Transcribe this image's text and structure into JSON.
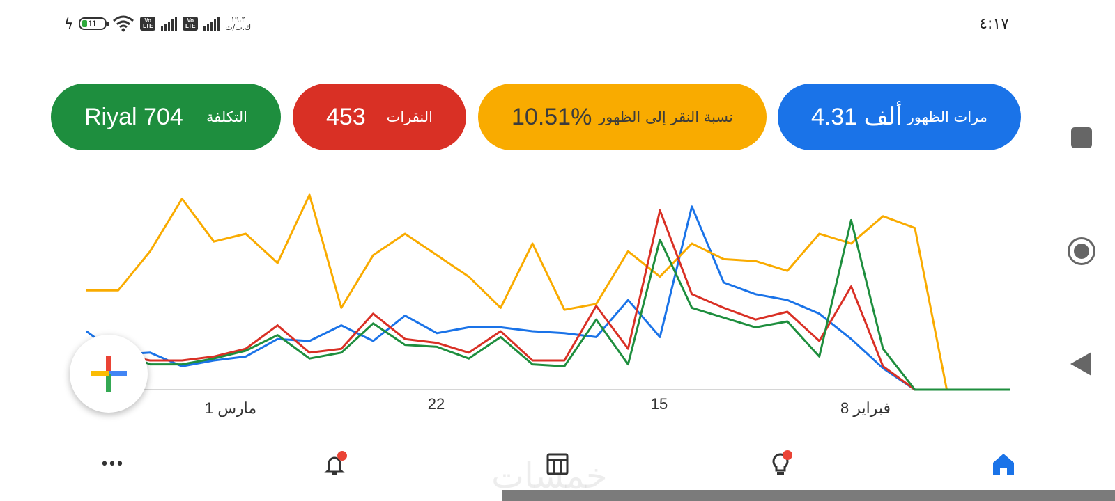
{
  "status_bar": {
    "time": "٤:١٧",
    "battery": "11",
    "network_speed_value": "١٩,٢",
    "network_speed_unit": "ك.ب/ث",
    "volte_label": "Vo LTE"
  },
  "metrics": [
    {
      "label": "مرات الظهور",
      "value": "4.31 ألف",
      "color": "#1a73e8"
    },
    {
      "label": "نسبة النقر إلى الظهور",
      "value": "10.51%",
      "color": "#f9ab00"
    },
    {
      "label": "النقرات",
      "value": "453",
      "color": "#d93025"
    },
    {
      "label": "التكلفة",
      "value": "Riyal 704",
      "color": "#1e8e3e"
    }
  ],
  "chart_data": {
    "type": "line",
    "x_tick_labels": [
      "مارس 1",
      "22",
      "15",
      "فبراير 8"
    ],
    "x_direction": "right-to-left (newest on left)",
    "normalized": true,
    "ylim": [
      0,
      100
    ],
    "grid": false,
    "series": [
      {
        "name": "مرات الظهور",
        "color": "#1a73e8",
        "values": [
          30,
          18,
          19,
          12,
          15,
          17,
          26,
          25,
          33,
          25,
          38,
          29,
          32,
          32,
          30,
          29,
          27,
          46,
          27,
          94,
          55,
          49,
          46,
          39,
          26,
          11,
          0,
          0,
          0,
          0
        ]
      },
      {
        "name": "نسبة النقر إلى الظهور",
        "color": "#f9ab00",
        "values": [
          51,
          51,
          71,
          98,
          76,
          80,
          65,
          100,
          42,
          69,
          80,
          69,
          58,
          42,
          75,
          41,
          44,
          71,
          58,
          75,
          67,
          66,
          61,
          80,
          75,
          89,
          83,
          0,
          0,
          0
        ]
      },
      {
        "name": "النقرات",
        "color": "#d93025",
        "values": [
          22,
          18,
          15,
          15,
          17,
          21,
          33,
          19,
          21,
          39,
          26,
          24,
          19,
          30,
          15,
          15,
          43,
          21,
          92,
          49,
          42,
          36,
          40,
          25,
          53,
          12,
          0,
          0,
          0,
          0
        ]
      },
      {
        "name": "التكلفة",
        "color": "#1e8e3e",
        "values": [
          22,
          20,
          13,
          13,
          16,
          20,
          28,
          16,
          19,
          34,
          23,
          22,
          16,
          27,
          13,
          12,
          36,
          13,
          77,
          42,
          37,
          32,
          35,
          17,
          87,
          21,
          0,
          0,
          0,
          0
        ]
      }
    ]
  },
  "bottom_nav": {
    "items": [
      "home-icon",
      "recommendations-icon",
      "campaigns-icon",
      "notifications-icon",
      "more-icon"
    ],
    "more_label": "•••",
    "active_color": "#1a73e8"
  },
  "watermark": "خمسات"
}
